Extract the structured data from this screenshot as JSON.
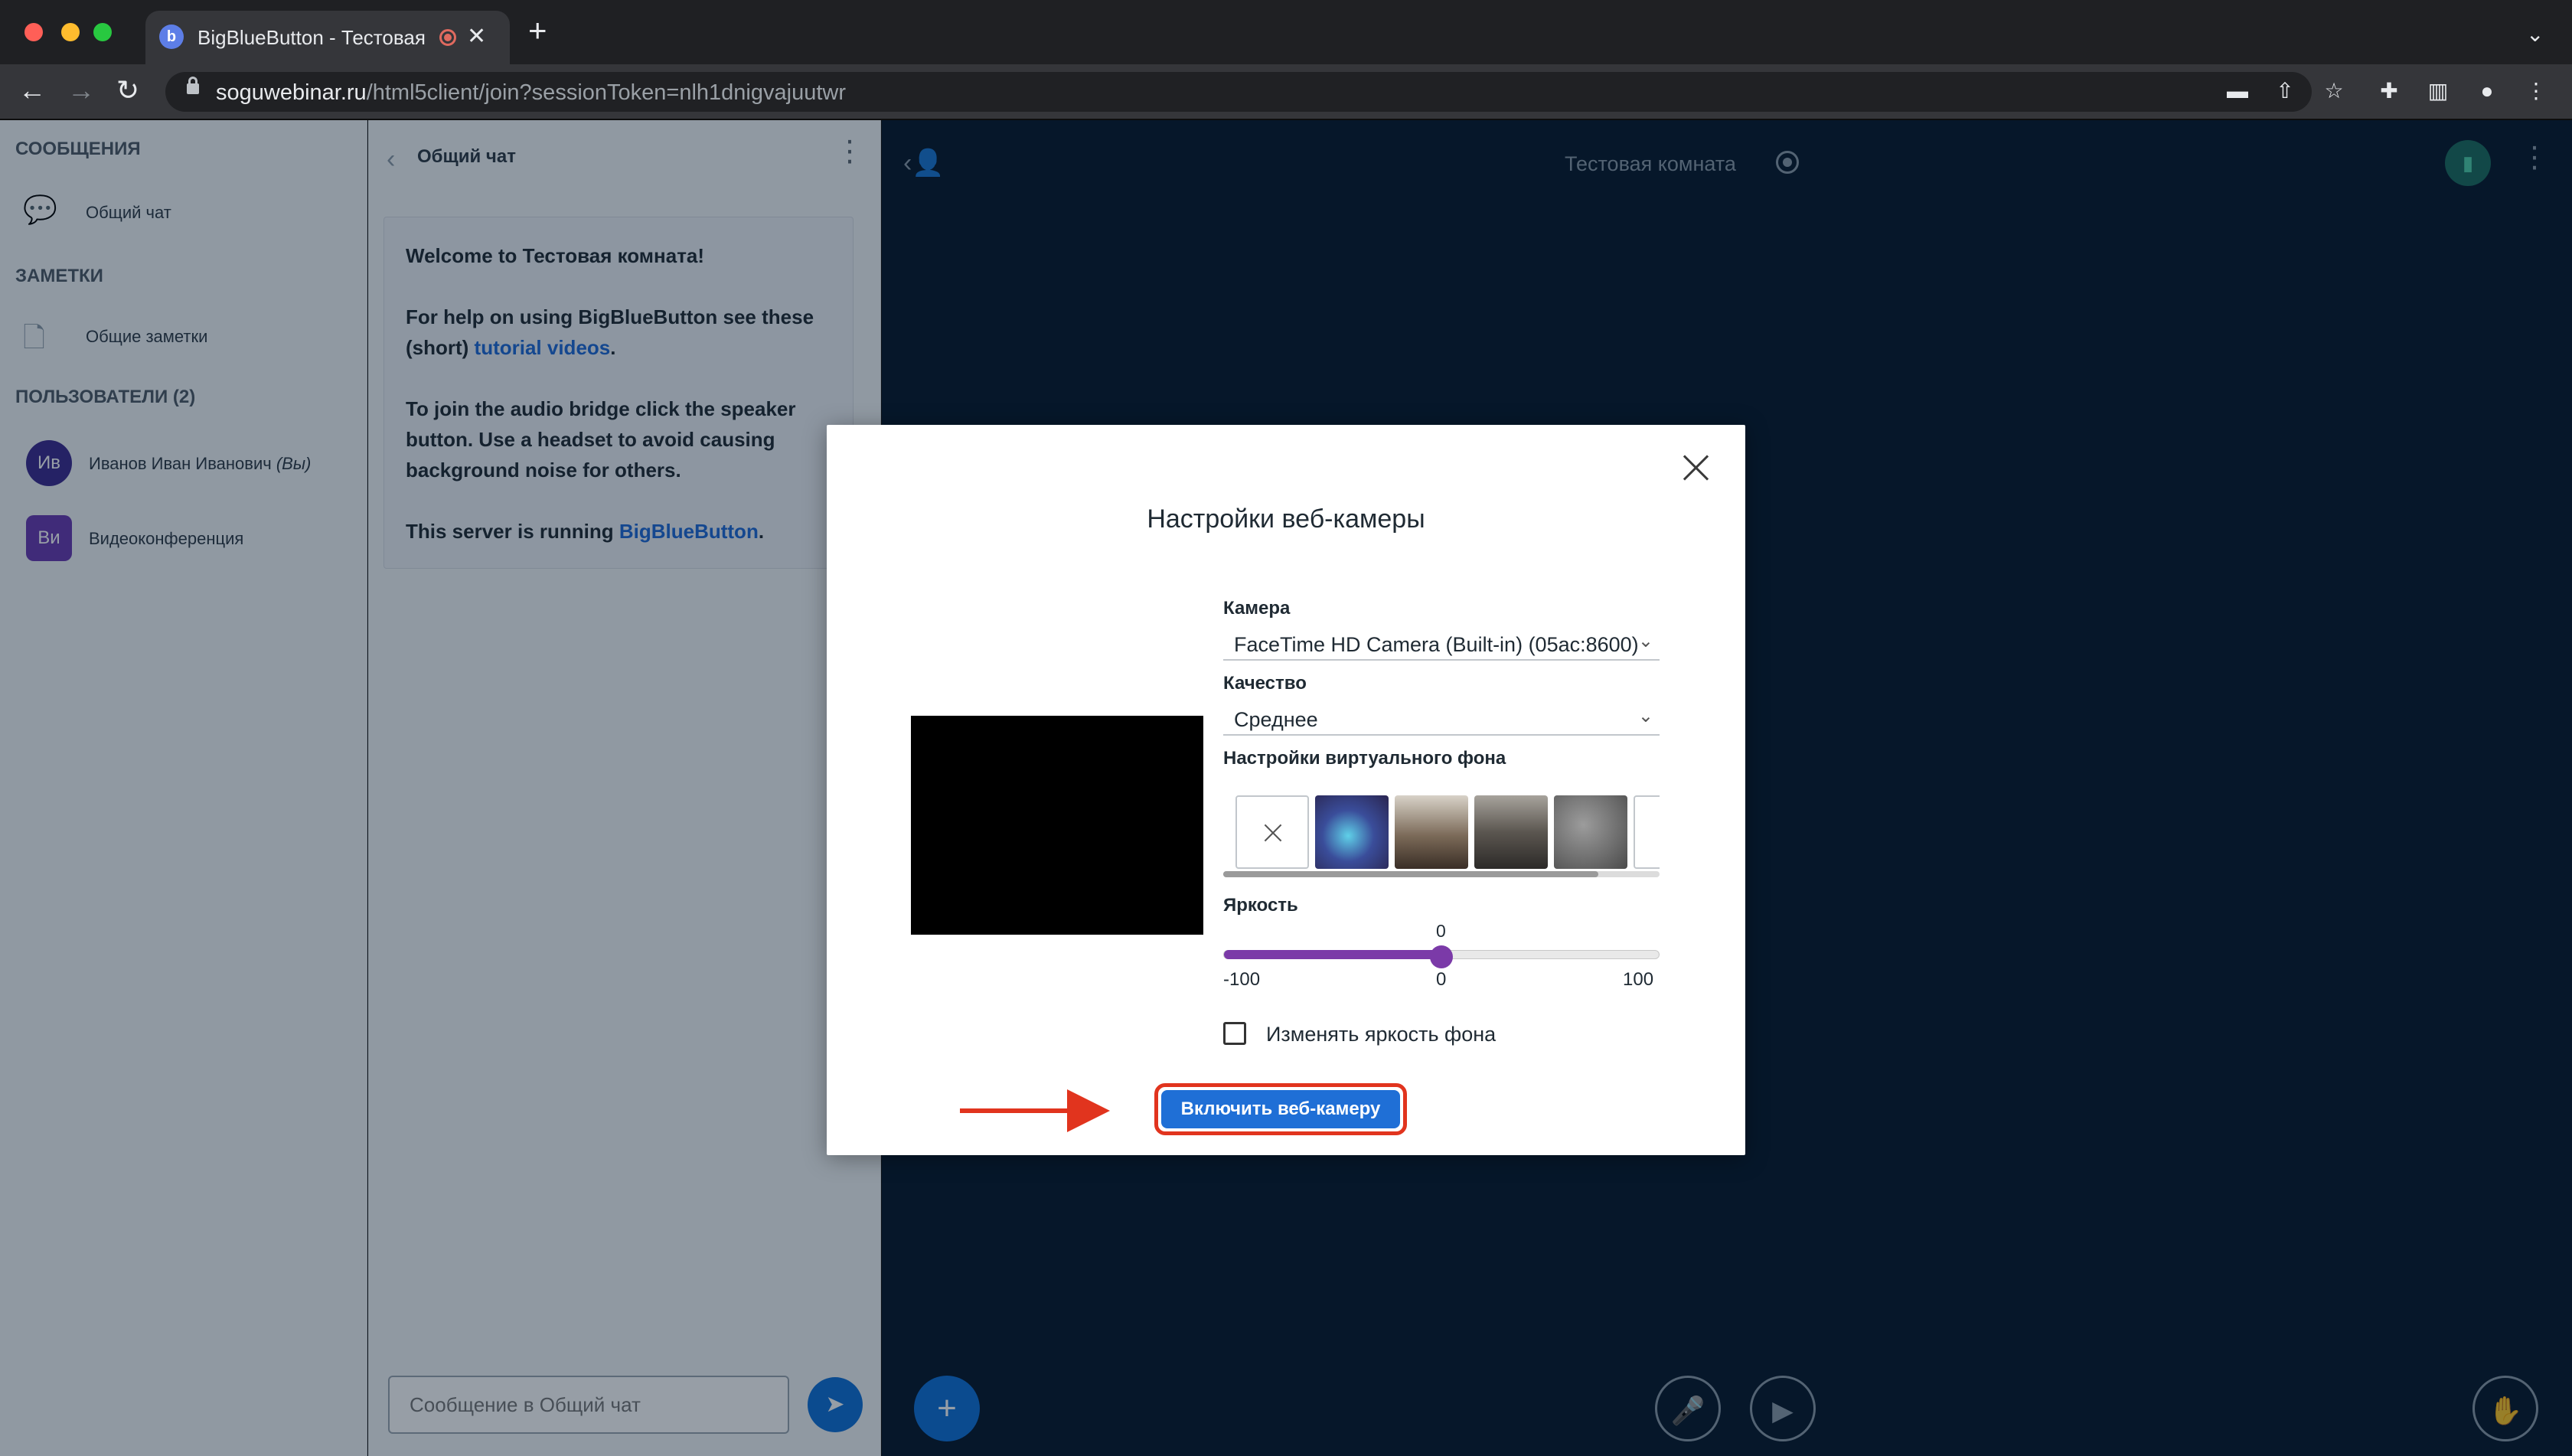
{
  "browser": {
    "tab_title": "BigBlueButton - Тестовая к",
    "tab_close": "✕",
    "new_tab": "+",
    "url_host": "soguwebinar.ru",
    "url_path": "/html5client/join?sessionToken=nlh1dnigvajuutwr"
  },
  "sidebar": {
    "messages_heading": "СООБЩЕНИЯ",
    "public_chat": "Общий чат",
    "notes_heading": "ЗАМЕТКИ",
    "shared_notes": "Общие заметки",
    "users_heading": "ПОЛЬЗОВАТЕЛИ (2)",
    "users": [
      {
        "initials": "Ив",
        "name": "Иванов Иван Иванович",
        "suffix": "(Вы)",
        "color": "#3b2a8f"
      },
      {
        "initials": "Ви",
        "name": "Видеоконференция",
        "suffix": "",
        "color": "#6a3ab2"
      }
    ]
  },
  "chat": {
    "title": "Общий чат",
    "welcome_line1": "Welcome to Тестовая комната!",
    "help_prefix": "For help on using BigBlueButton see these (short) ",
    "help_link": "tutorial videos",
    "help_suffix": ".",
    "audio_hint": "To join the audio bridge click the speaker button. Use a headset to avoid causing background noise for others.",
    "server_prefix": "This server is running ",
    "server_link": "BigBlueButton",
    "server_suffix": ".",
    "input_placeholder": "Сообщение в Общий чат"
  },
  "main": {
    "room_title": "Тестовая комната"
  },
  "modal": {
    "title": "Настройки веб-камеры",
    "camera_label": "Камера",
    "camera_value": "FaceTime HD Camera (Built-in) (05ac:8600)",
    "quality_label": "Качество",
    "quality_value": "Среднее",
    "virtual_bg_label": "Настройки виртуального фона",
    "brightness_label": "Яркость",
    "brightness_value": "0",
    "brightness_min": "-100",
    "brightness_mid": "0",
    "brightness_max": "100",
    "brightness_fraction": 0.5,
    "bg_checkbox_label": "Изменять яркость фона",
    "enable_button": "Включить веб-камеру"
  },
  "colors": {
    "accent_blue": "#1f6fd6",
    "slider_purple": "#7b3aa8",
    "highlight_red": "#e1341e",
    "main_bg": "#06172a"
  }
}
